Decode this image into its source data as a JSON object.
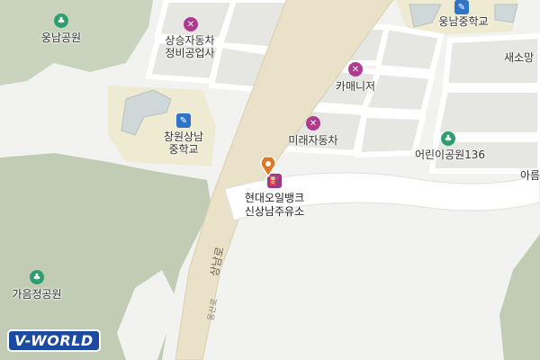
{
  "map": {
    "colors": {
      "background": "#f2f2f0",
      "block": "#e6e6e3",
      "park": "#c9d3bd",
      "hill": "#c2ccb4",
      "school": "#eeebd2",
      "road_main": "#e9e2c8",
      "road_minor": "#ffffff"
    },
    "labels": {
      "ungnam_park": "웅남공원",
      "ungnam_middle": "웅남중학교",
      "sangseung": "상승자동차",
      "sangseung2": "정비공업사",
      "camani": "카매니저",
      "mirae": "미래자동차",
      "changwon_sangnam": "창원상남",
      "changwon_sangnam2": "중학교",
      "playground": "어린이공원136",
      "hyundai_oil": "현대오일뱅크",
      "hyundai_oil2": "신상남주유소",
      "gaeumjeong_park": "가음정공원",
      "saesomang": "새소망",
      "areum": "아름",
      "road_name": "상남로",
      "road_small": "웅산로"
    },
    "icons": {
      "park_icon": "park",
      "school_icon": "school",
      "repair_icon": "wrench",
      "fuel_icon": "fuel-pump",
      "marker_icon": "location-pin"
    },
    "logo": "V-WORLD"
  }
}
